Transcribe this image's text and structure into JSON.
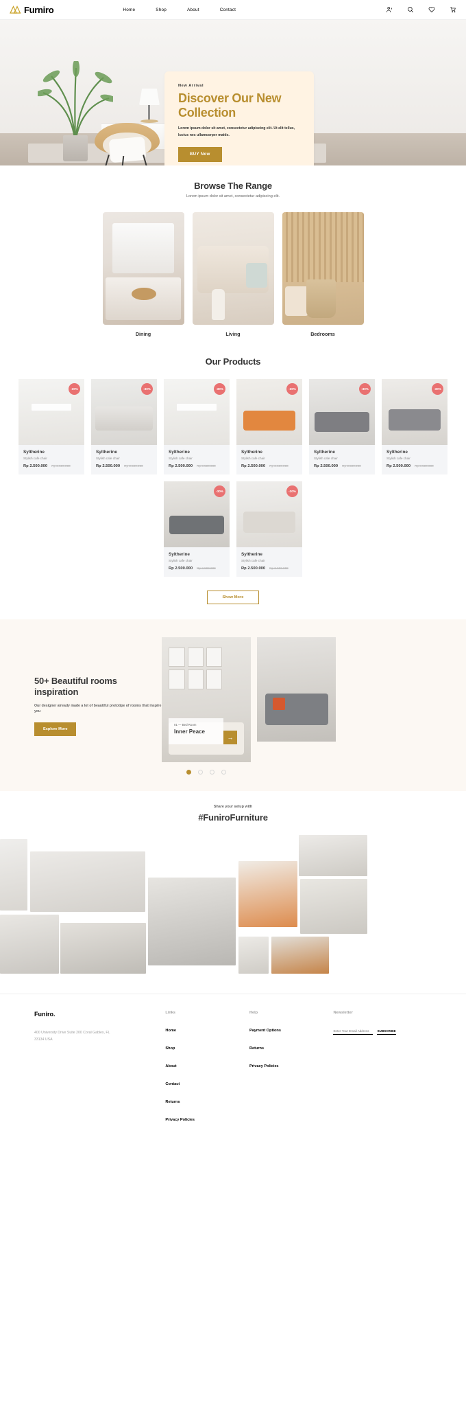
{
  "header": {
    "brand": "Furniro",
    "nav": [
      {
        "label": "Home"
      },
      {
        "label": "Shop"
      },
      {
        "label": "About"
      },
      {
        "label": "Contact"
      }
    ],
    "icons": [
      {
        "name": "account-icon"
      },
      {
        "name": "search-icon"
      },
      {
        "name": "heart-icon"
      },
      {
        "name": "cart-icon"
      }
    ]
  },
  "hero": {
    "eyebrow": "New Arrival",
    "title": "Discover Our New Collection",
    "subtitle": "Lorem ipsum dolor sit amet, consectetur adipiscing elit. Ut elit tellus, luctus nec ullamcorper mattis.",
    "button": "BUY Now",
    "card_bg": "#FFF3E3",
    "accent": "#B88E2F"
  },
  "browse": {
    "title": "Browse The Range",
    "subtitle": "Lorem ipsum dolor sit amet, consectetur adipiscing elit.",
    "categories": [
      {
        "label": "Dining"
      },
      {
        "label": "Living"
      },
      {
        "label": "Bedrooms"
      }
    ]
  },
  "products": {
    "title": "Our Products",
    "show_more": "Show More",
    "items": [
      {
        "name": "Syltherine",
        "desc": "Stylish cafe chair",
        "price": "Rp 2.500.000",
        "old_price": "Rp 3.500.000",
        "badge": "-30%",
        "badge_type": "discount"
      },
      {
        "name": "Syltherine",
        "desc": "Stylish cafe chair",
        "price": "Rp 2.500.000",
        "old_price": "Rp 3.500.000",
        "badge": "-30%",
        "badge_type": "discount"
      },
      {
        "name": "Syltherine",
        "desc": "Stylish cafe chair",
        "price": "Rp 2.500.000",
        "old_price": "Rp 3.500.000",
        "badge": "-30%",
        "badge_type": "discount"
      },
      {
        "name": "Syltherine",
        "desc": "Stylish cafe chair",
        "price": "Rp 2.500.000",
        "old_price": "Rp 3.500.000",
        "badge": "-30%",
        "badge_type": "discount"
      },
      {
        "name": "Syltherine",
        "desc": "Stylish cafe chair",
        "price": "Rp 2.500.000",
        "old_price": "Rp 3.500.000",
        "badge": "-30%",
        "badge_type": "discount"
      },
      {
        "name": "Syltherine",
        "desc": "Stylish cafe chair",
        "price": "Rp 2.500.000",
        "old_price": "Rp 3.500.000",
        "badge": "-30%",
        "badge_type": "discount"
      },
      {
        "name": "Syltherine",
        "desc": "Stylish cafe chair",
        "price": "Rp 2.500.000",
        "old_price": "Rp 3.500.000",
        "badge": "-30%",
        "badge_type": "discount"
      },
      {
        "name": "Syltherine",
        "desc": "Stylish cafe chair",
        "price": "Rp 2.500.000",
        "old_price": "Rp 3.500.000",
        "badge": "-30%",
        "badge_type": "discount"
      }
    ]
  },
  "inspiration": {
    "title": "50+ Beautiful rooms inspiration",
    "text": "Our designer already made a lot of beautiful prototipe of rooms that inspire you",
    "button": "Explore More",
    "slide_eyebrow": "01 — Bed Room",
    "slide_title": "Inner Peace",
    "arrow": "→",
    "dots": 4,
    "active_dot": 0
  },
  "share": {
    "eyebrow": "Share your setup with",
    "hashtag": "#FuniroFurniture"
  },
  "footer": {
    "brand": "Funiro.",
    "address": "400 University Drive Suite 200 Coral Gables, FL 33134 USA",
    "links_head": "Links",
    "links": [
      {
        "label": "Home"
      },
      {
        "label": "Shop"
      },
      {
        "label": "About"
      },
      {
        "label": "Contact"
      },
      {
        "label": "Returns"
      },
      {
        "label": "Privacy Policies"
      }
    ],
    "help_head": "Help",
    "help": [
      {
        "label": "Payment Options"
      },
      {
        "label": "Returns"
      },
      {
        "label": "Privacy Policies"
      }
    ],
    "newsletter_head": "Newsletter",
    "newsletter_placeholder": "Enter Your Email Address",
    "subscribe": "SUBSCRIBE"
  }
}
